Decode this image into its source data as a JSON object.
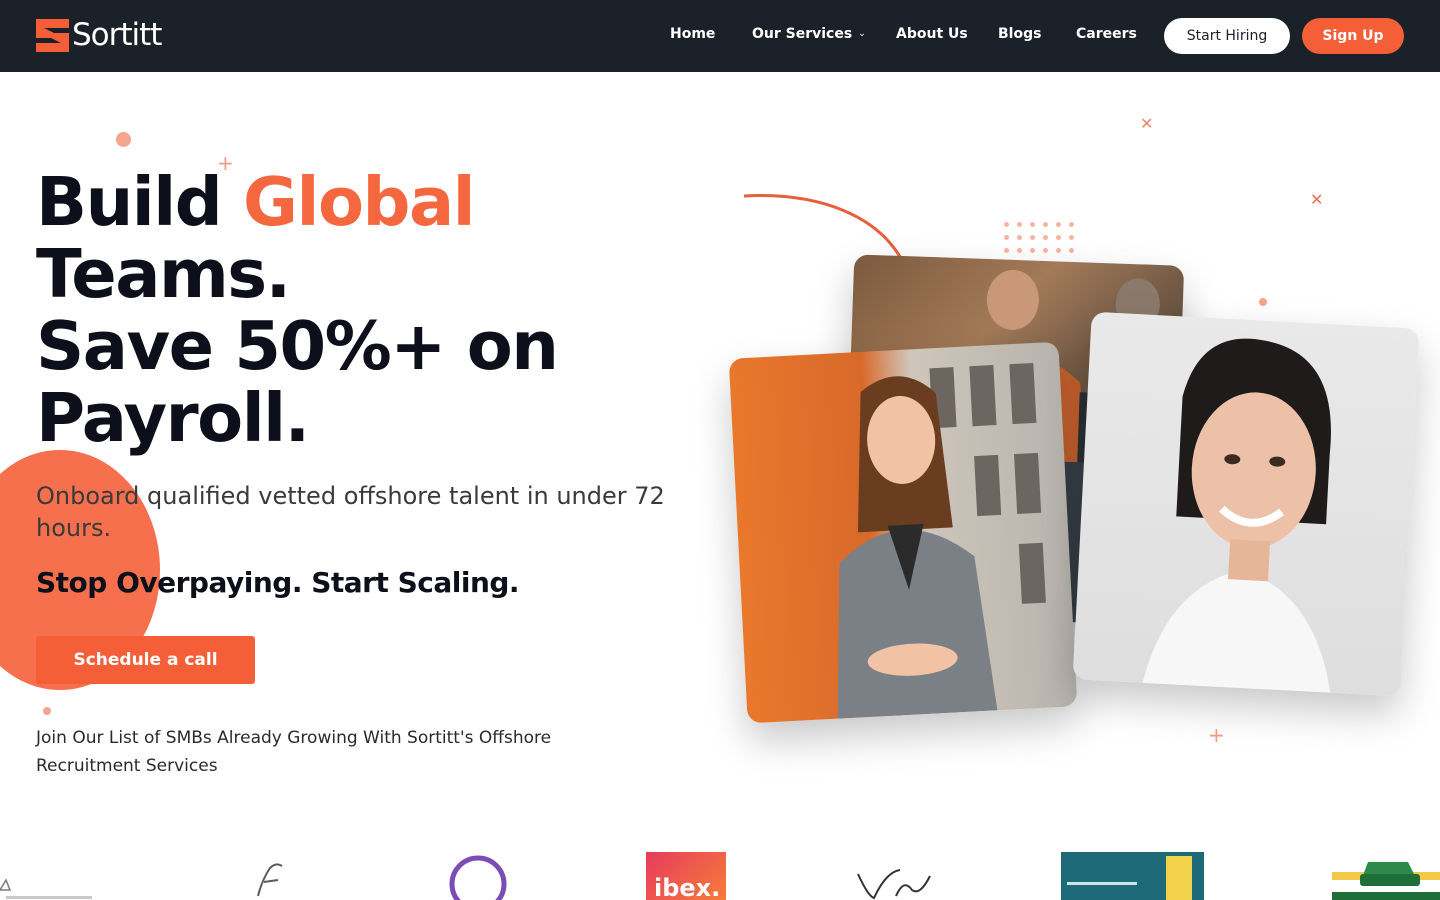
{
  "brand": {
    "name": "Sortitt",
    "accent": "#f55f38",
    "nav_bg": "#1b2129"
  },
  "nav": {
    "links": [
      "Home",
      "Our Services",
      "About Us",
      "Blogs",
      "Careers"
    ],
    "services_icon": "chevron-down-icon",
    "start_hiring": "Start Hiring",
    "sign_up": "Sign Up"
  },
  "hero": {
    "title_1": "Build",
    "title_accent": "Global",
    "title_2": "Teams.",
    "title_3": "Save 50%+ on",
    "title_4": "Payroll.",
    "subtitle": "Onboard qualified vetted offshore talent in under 72 hours.",
    "tagline": "Stop Overpaying. Start Scaling.",
    "cta": "Schedule a call",
    "join_text": "Join Our List of SMBs Already Growing With Sortitt's Offshore Recruitment Services"
  },
  "client_logos": {
    "ibex": "ibex."
  }
}
